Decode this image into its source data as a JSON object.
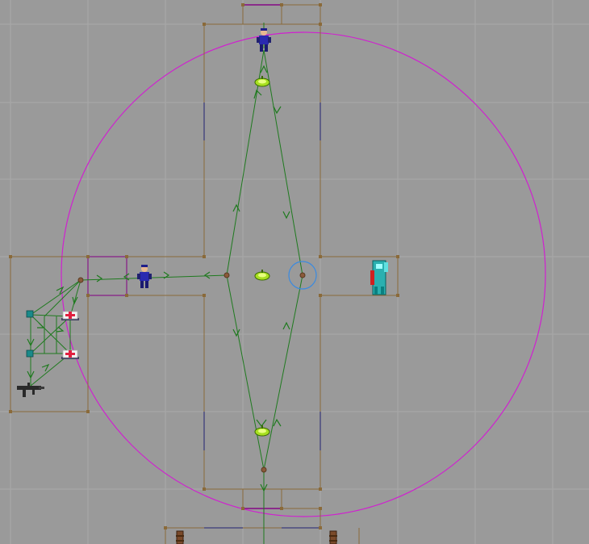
{
  "editor": {
    "view": "2d-map-top-view",
    "grid": "on",
    "colors": {
      "background": "#9a9a9a",
      "grid_line": "#a8a8a8",
      "sector_line": "#8a6a3a",
      "sector_vertex": "#8a6a3a",
      "door_line": "#8a2c8a",
      "wall_blue_line": "#4a4a80",
      "path_line": "#1f7a1f",
      "radius_circle": "#d020d0",
      "selection_circle": "#3a8ae0"
    },
    "map_objects": [
      {
        "id": "guard-top",
        "type": "guard",
        "icon": "guard-blue-icon"
      },
      {
        "id": "guard-left",
        "type": "guard",
        "icon": "guard-blue-icon"
      },
      {
        "id": "robot",
        "type": "enemy",
        "icon": "robot-icon"
      },
      {
        "id": "ceiling-light-1",
        "type": "light",
        "icon": "green-lamp-icon"
      },
      {
        "id": "ceiling-light-2",
        "type": "light",
        "icon": "green-lamp-icon"
      },
      {
        "id": "ceiling-light-3",
        "type": "light",
        "icon": "green-lamp-icon"
      },
      {
        "id": "medkit-1",
        "type": "item",
        "icon": "medkit-icon"
      },
      {
        "id": "medkit-2",
        "type": "item",
        "icon": "medkit-icon"
      },
      {
        "id": "ammo-1",
        "type": "item",
        "icon": "ammo-box-icon"
      },
      {
        "id": "ammo-2",
        "type": "item",
        "icon": "ammo-box-icon"
      },
      {
        "id": "weapon",
        "type": "item",
        "icon": "machine-gun-icon"
      },
      {
        "id": "barrel-1",
        "type": "decoration",
        "icon": "barrel-icon"
      },
      {
        "id": "barrel-2",
        "type": "decoration",
        "icon": "barrel-icon"
      }
    ]
  }
}
